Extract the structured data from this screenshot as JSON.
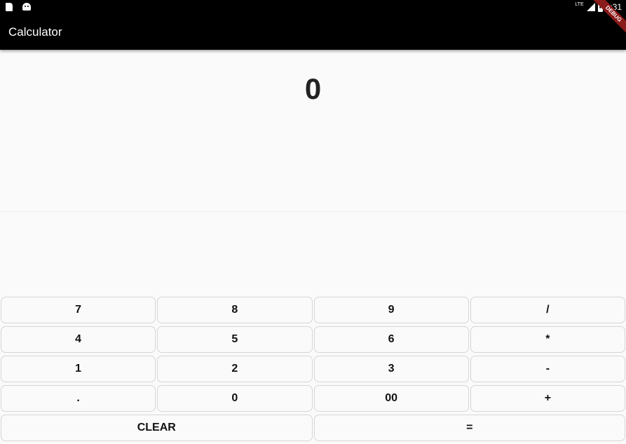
{
  "status_bar": {
    "network_label": "LTE",
    "time": "1:31"
  },
  "app_bar": {
    "title": "Calculator",
    "debug_banner": "DEBUG"
  },
  "display": {
    "value": "0"
  },
  "keypad": {
    "rows": [
      [
        "7",
        "8",
        "9",
        "/"
      ],
      [
        "4",
        "5",
        "6",
        "*"
      ],
      [
        "1",
        "2",
        "3",
        "-"
      ],
      [
        ".",
        "0",
        "00",
        "+"
      ],
      [
        "CLEAR",
        "="
      ]
    ]
  }
}
